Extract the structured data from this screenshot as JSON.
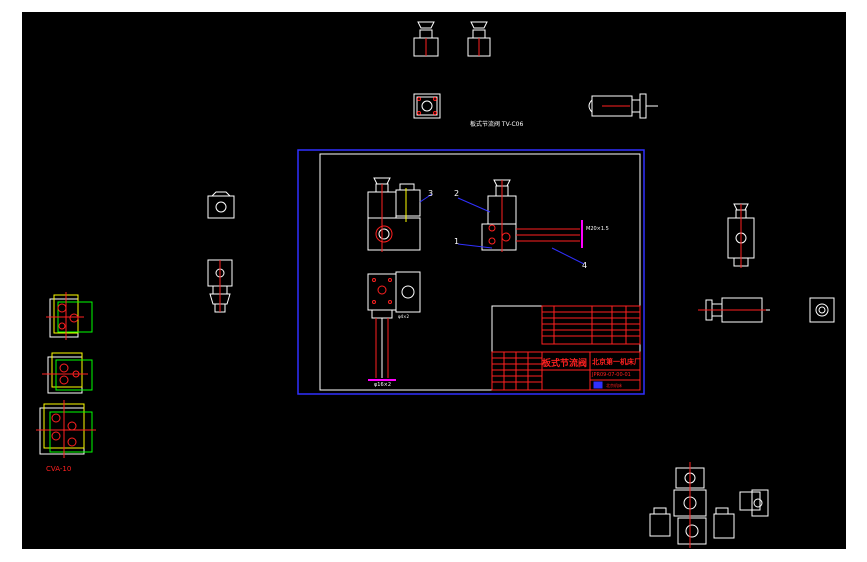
{
  "colors": {
    "page_bg": "#ffffff",
    "canvas_bg": "#000000",
    "line_white": "#ffffff",
    "line_red": "#ff2020",
    "line_blue": "#3030ff",
    "line_magenta": "#ff00ff",
    "line_yellow": "#ffff00",
    "line_green": "#00ff00",
    "line_cyan": "#00ffff"
  },
  "labels": {
    "top_caption": "板式节流阀 TV-C06",
    "balloon_1": "1",
    "balloon_2": "2",
    "balloon_3": "3",
    "balloon_4": "4",
    "pipe_note": "M20×1.5",
    "dim_note": "φ4×2",
    "bottom_note": "φ16×2",
    "cva_label": "CVA-10",
    "title_name": "板式节流阀",
    "title_company": "北京第一机床厂",
    "drawing_no": "JPR09-07-00-01",
    "logo_text": "北京机床"
  }
}
